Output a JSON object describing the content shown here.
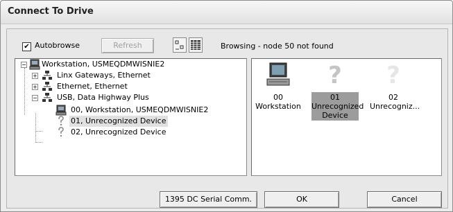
{
  "window": {
    "title": "Connect To Drive"
  },
  "toolbar": {
    "autobrowse_label": "Autobrowse",
    "autobrowse_checked": true,
    "autobrowse_mark": "✔",
    "refresh_label": "Refresh",
    "status_text": "Browsing - node 50 not found"
  },
  "tree": {
    "items": [
      {
        "label": "Workstation, USMEQDMWISNIE2",
        "icon": "computer-icon",
        "expander": "−"
      },
      {
        "label": "Linx Gateways, Ethernet",
        "icon": "network-icon",
        "expander": "+"
      },
      {
        "label": "Ethernet, Ethernet",
        "icon": "network-icon",
        "expander": "+"
      },
      {
        "label": "USB, Data Highway Plus",
        "icon": "network-icon",
        "expander": "−"
      },
      {
        "label": "00, Workstation, USMEQDMWISNIE2",
        "icon": "computer-icon"
      },
      {
        "label": "01, Unrecognized Device",
        "icon": "question-icon",
        "selected": true
      },
      {
        "label": "02, Unrecognized Device",
        "icon": "question-icon"
      }
    ]
  },
  "nodes": [
    {
      "num": "00",
      "name": "Workstation",
      "icon": "computer-icon"
    },
    {
      "num": "01",
      "name": "Unrecognized Device",
      "icon": "question-icon",
      "selected": true
    },
    {
      "num": "02",
      "name": "Unrecogniz...",
      "icon": "question-icon"
    }
  ],
  "buttons": {
    "serial_label": "1395 DC Serial Comm.",
    "ok_label": "OK",
    "cancel_label": "Cancel"
  },
  "colors": {
    "selection_gray": "#9c9c9c",
    "window_bg": "#e8e8e8"
  }
}
